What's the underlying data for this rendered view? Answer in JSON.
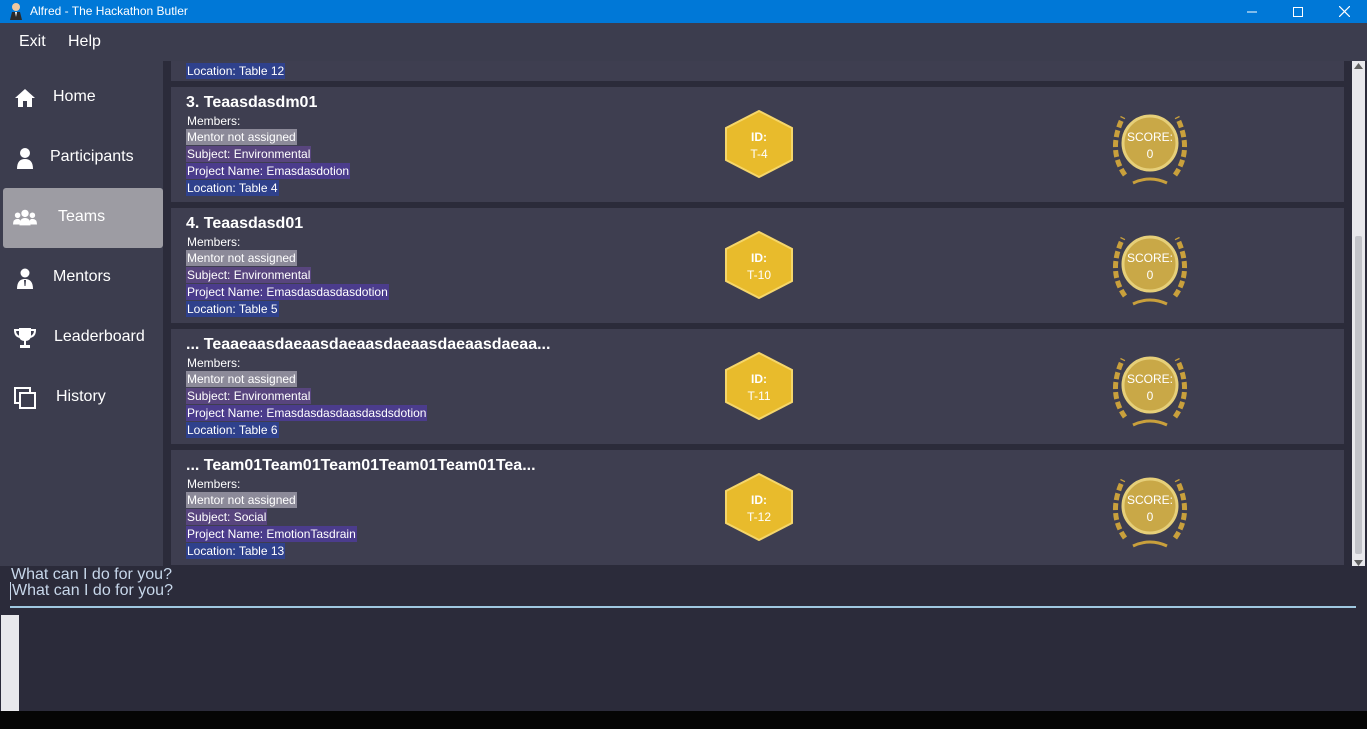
{
  "window": {
    "title": "Alfred - The Hackathon Butler",
    "icon": "butler-avatar-icon",
    "controls": [
      "minimize-icon",
      "maximize-icon",
      "close-icon"
    ]
  },
  "menu": {
    "exit": "Exit",
    "help": "Help"
  },
  "sidebar": {
    "items": [
      {
        "label": "Home",
        "icon": "home-icon"
      },
      {
        "label": "Participants",
        "icon": "person-icon"
      },
      {
        "label": "Teams",
        "icon": "group-icon",
        "active": true
      },
      {
        "label": "Mentors",
        "icon": "mentor-icon"
      },
      {
        "label": "Leaderboard",
        "icon": "trophy-icon"
      },
      {
        "label": "History",
        "icon": "history-icon"
      }
    ]
  },
  "teams": {
    "partial_top": {
      "location": "Location:  Table 12"
    },
    "cards": [
      {
        "title": "3.  Teaasdasdm01",
        "members": "Members:",
        "mentor": "Mentor not assigned",
        "subject": "Subject: Environmental",
        "project": "Project Name: Emasdasdotion",
        "location": "Location:  Table 4",
        "id_label": "ID:",
        "id_value": "T-4",
        "score_label": "SCORE:",
        "score_value": "0"
      },
      {
        "title": "4.  Teaasdasd01",
        "members": "Members:",
        "mentor": "Mentor not assigned",
        "subject": "Subject: Environmental",
        "project": "Project Name: Emasdasdasdasdotion",
        "location": "Location:  Table 5",
        "id_label": "ID:",
        "id_value": "T-10",
        "score_label": "SCORE:",
        "score_value": "0"
      },
      {
        "title": "... Teaaeaasdaeaasdaeaasdaeaasdaeaasdaeaa...",
        "members": "Members:",
        "mentor": "Mentor not assigned",
        "subject": "Subject: Environmental",
        "project": "Project Name: Emasdasdasdaasdasdsdotion",
        "location": "Location:  Table 6",
        "id_label": "ID:",
        "id_value": "T-11",
        "score_label": "SCORE:",
        "score_value": "0"
      },
      {
        "title": "... Team01Team01Team01Team01Team01Tea...",
        "members": "Members:",
        "mentor": "Mentor not assigned",
        "subject": "Subject: Social",
        "project": "Project Name: EmotionTasdrain",
        "location": "Location:  Table 13",
        "id_label": "ID:",
        "id_value": "T-12",
        "score_label": "SCORE:",
        "score_value": "0"
      }
    ]
  },
  "console": {
    "response": "What can I do for you?",
    "input_value": "What can I do for you?"
  },
  "colors": {
    "titlebar": "#0078d7",
    "panel": "#3c3d4e",
    "card": "#3e3e50",
    "hex_gold": "#e8bb2c",
    "mentor_bg": "#8c8a99",
    "subject_bg": "#58457e",
    "project_bg": "#4b3c8c",
    "location_bg": "#2f418c"
  }
}
